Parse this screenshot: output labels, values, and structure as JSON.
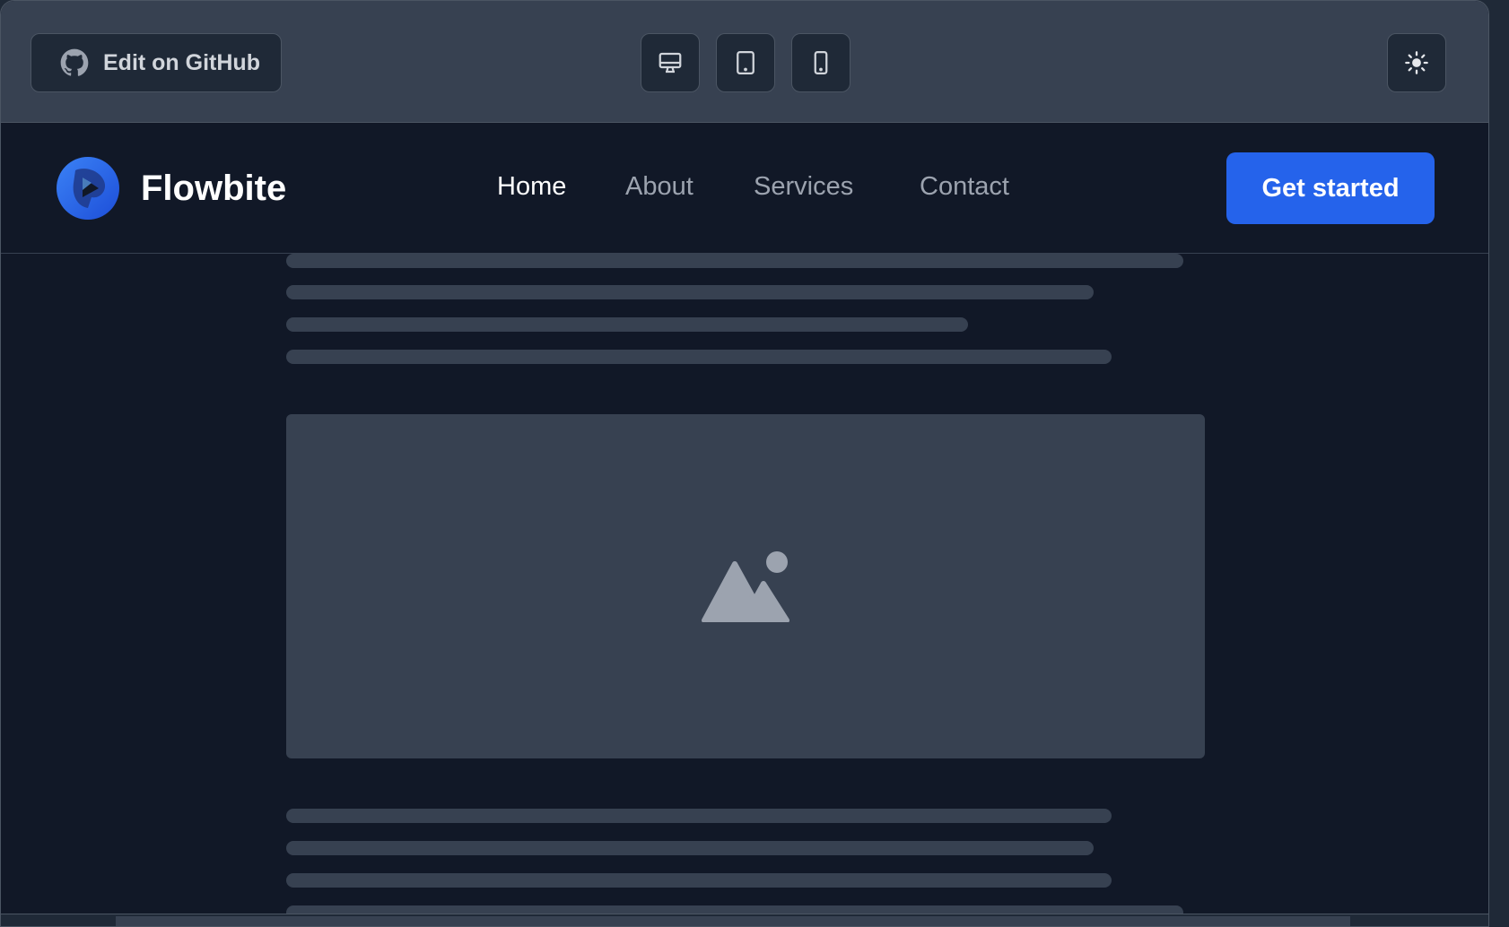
{
  "toolbar": {
    "github_label": "Edit on GitHub",
    "device_buttons": [
      "desktop-icon",
      "tablet-icon",
      "mobile-icon"
    ],
    "theme_toggle": "sun-icon"
  },
  "navbar": {
    "brand": "Flowbite",
    "links": [
      "Home",
      "About",
      "Services",
      "Contact"
    ],
    "active": "Home",
    "cta": "Get started"
  },
  "colors": {
    "accent": "#2563eb",
    "background": "#111827",
    "skeleton": "#374151"
  },
  "placeholder_icon": "image-icon"
}
